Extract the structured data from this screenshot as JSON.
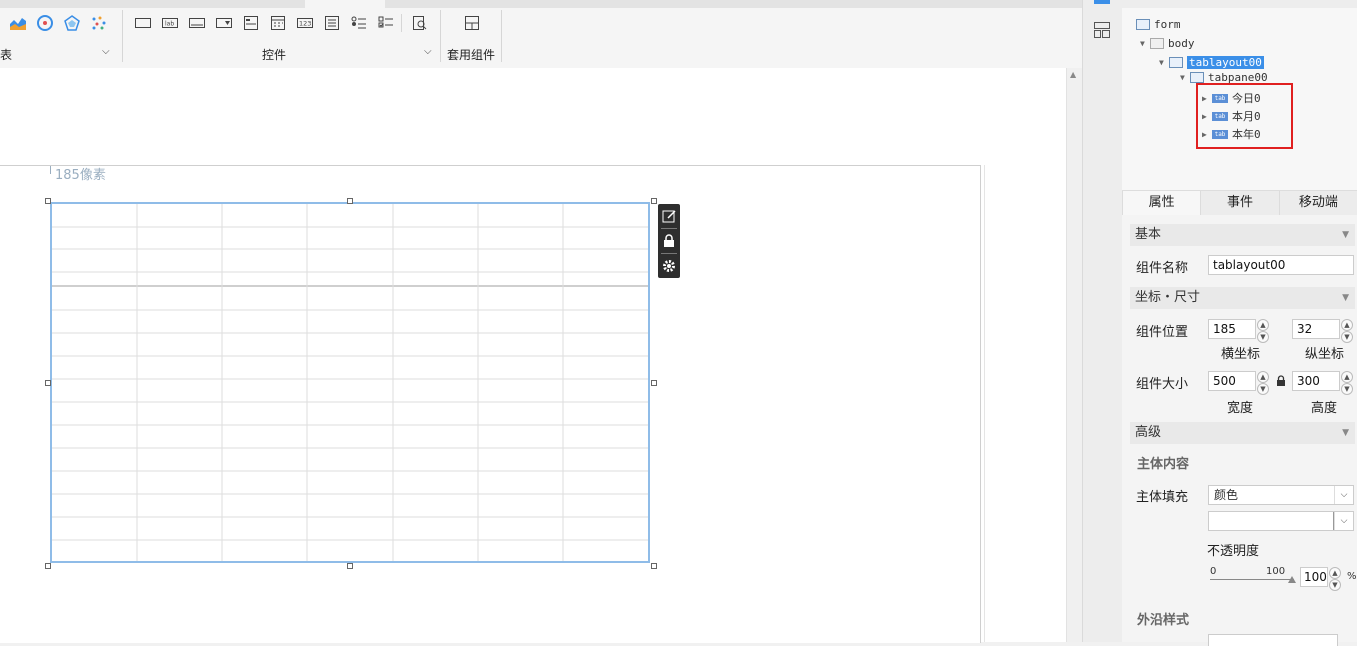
{
  "ribbon": {
    "group_left_label": "表",
    "group_controls_label": "控件",
    "group_template_label": "套用组件",
    "icons_left": [
      "chart-area-icon",
      "gauge-icon",
      "radar-icon",
      "scatter-icon"
    ],
    "icons_controls": [
      "label-box-icon",
      "lab-icon",
      "button-icon",
      "combo-icon",
      "frame-icon",
      "calendar-icon",
      "number-123-icon",
      "list-icon",
      "checkbox-list-icon",
      "radio-list-icon",
      "search-doc-icon"
    ],
    "template_icon": "layout-template-icon"
  },
  "canvas": {
    "coord_label": "185像素"
  },
  "tree": {
    "nodes": [
      {
        "label": "form"
      },
      {
        "label": "body"
      },
      {
        "label": "tablayout00"
      },
      {
        "label": "tabpane00"
      },
      {
        "label": "今日0"
      },
      {
        "label": "本月0"
      },
      {
        "label": "本年0"
      }
    ]
  },
  "props": {
    "tabs": [
      "属性",
      "事件",
      "移动端"
    ],
    "section_basic": "基本",
    "name_label": "组件名称",
    "name_value": "tablayout00",
    "section_pos": "坐标・尺寸",
    "pos_label": "组件位置",
    "x_value": "185",
    "y_value": "32",
    "x_caption": "横坐标",
    "y_caption": "纵坐标",
    "size_label": "组件大小",
    "width_value": "500",
    "height_value": "300",
    "width_caption": "宽度",
    "height_caption": "高度",
    "section_adv": "高级",
    "body_content": "主体内容",
    "fill_label": "主体填充",
    "fill_value": "颜色",
    "opacity_label": "不透明度",
    "slider_min": "0",
    "slider_max": "100",
    "opacity_value": "100",
    "percent": "%",
    "border_style": "外沿样式"
  },
  "colors": {
    "selection": "#8fbce8",
    "tree_selected": "#3b8fe8",
    "highlight_box": "#e02020"
  }
}
